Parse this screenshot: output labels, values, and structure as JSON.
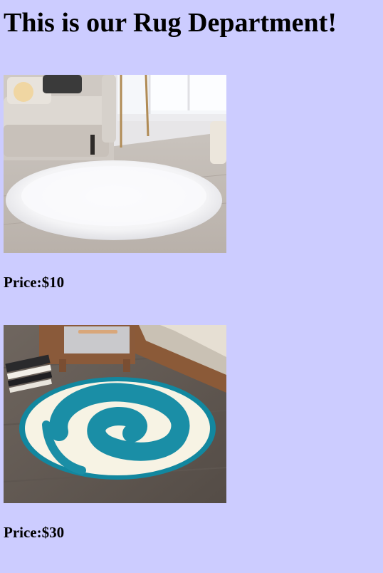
{
  "page": {
    "title": "This is our Rug Department!",
    "background_color": "#ccccff"
  },
  "products": [
    {
      "image_icon": "white-round-fur-rug-photo",
      "price_label": "Price:$10"
    },
    {
      "image_icon": "blue-white-swirl-fur-rug-photo",
      "price_label": "Price:$30"
    }
  ]
}
